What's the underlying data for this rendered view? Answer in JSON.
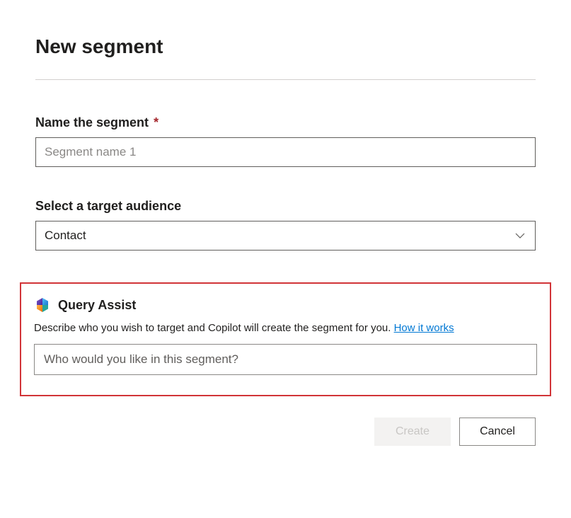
{
  "page": {
    "title": "New segment"
  },
  "form": {
    "nameField": {
      "label": "Name the segment",
      "required": true,
      "placeholder": "Segment name 1",
      "value": ""
    },
    "audienceField": {
      "label": "Select a target audience",
      "selected": "Contact"
    }
  },
  "queryAssist": {
    "title": "Query Assist",
    "description": "Describe who you wish to target and Copilot will create the segment for you.",
    "linkText": "How it works",
    "inputPlaceholder": "Who would you like in this segment?",
    "inputValue": ""
  },
  "buttons": {
    "create": "Create",
    "cancel": "Cancel"
  }
}
